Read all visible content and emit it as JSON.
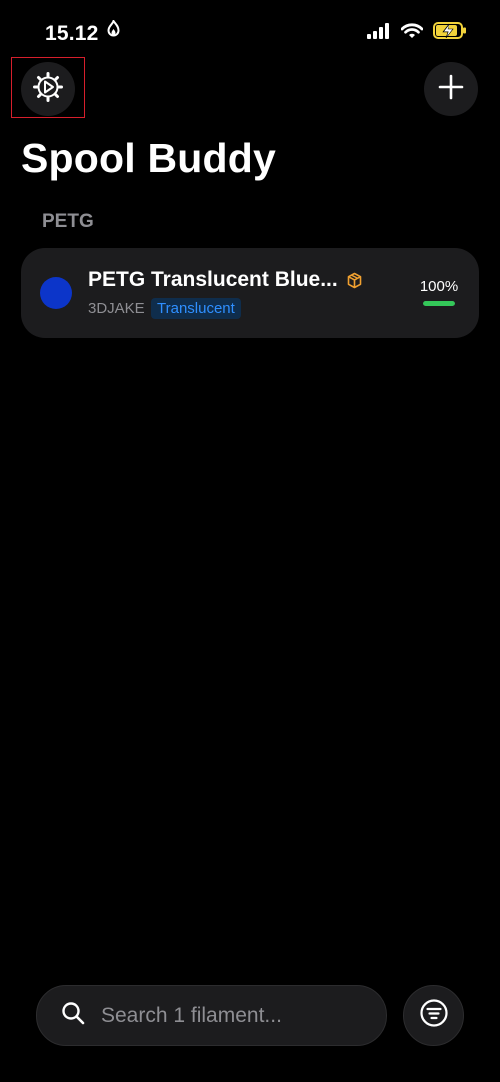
{
  "status_bar": {
    "time": "15.12",
    "icons": [
      "activity-icon",
      "signal-icon",
      "wifi-icon",
      "battery-icon"
    ],
    "battery_color": "#f2d33b"
  },
  "header": {
    "title": "Spool Buddy",
    "settings_icon": "settings-gear-play-icon",
    "add_icon": "plus-icon"
  },
  "sections": [
    {
      "label": "PETG",
      "items": [
        {
          "name": "PETG Translucent Blue...",
          "brand": "3DJAKE",
          "tag": "Translucent",
          "percent_label": "100%",
          "progress": 1.0,
          "swatch_color": "#0c35c9",
          "status_icon": "box-icon"
        }
      ]
    }
  ],
  "search": {
    "placeholder": "Search 1 filament..."
  },
  "filter": {
    "icon": "filter-icon"
  },
  "colors": {
    "accent": "#2f8fff",
    "progress": "#34c759",
    "card": "#1c1c1e",
    "muted": "#8e8e93"
  }
}
